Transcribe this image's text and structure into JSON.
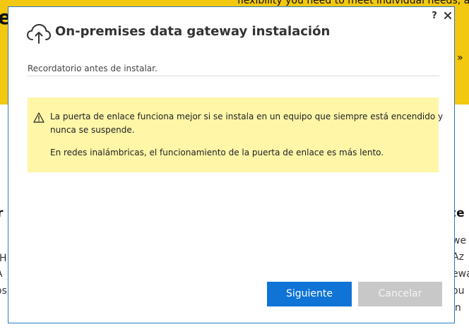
{
  "background_page": {
    "hero_text": "flexibility you need to meet individual needs, a",
    "hero_big_letter": "e",
    "link_text": "e »",
    "left_heading": "r",
    "right_heading": "ce",
    "left_lines": [
      "-H",
      "A",
      "os"
    ],
    "right_lines": [
      "we",
      "Az",
      "ewa",
      "ou",
      "in"
    ],
    "banner_color": "#f2c811"
  },
  "dialog": {
    "title": "On-premises data gateway instalación",
    "title_icon": "cloud-upload-icon",
    "help_label": "?",
    "close_icon": "close-icon",
    "subtitle": "Recordatorio antes de instalar.",
    "warning": {
      "icon": "warning-icon",
      "line1": "La puerta de enlace funciona mejor si se instala en un equipo que siempre está encendido y",
      "line2": "nunca se suspende.",
      "line3": "En redes inalámbricas, el funcionamiento de la puerta de enlace es más lento.",
      "background_color": "#fff6a8"
    },
    "buttons": {
      "next_label": "Siguiente",
      "cancel_label": "Cancelar",
      "next_color": "#0f74d6",
      "cancel_color": "#c8c8c8"
    }
  }
}
